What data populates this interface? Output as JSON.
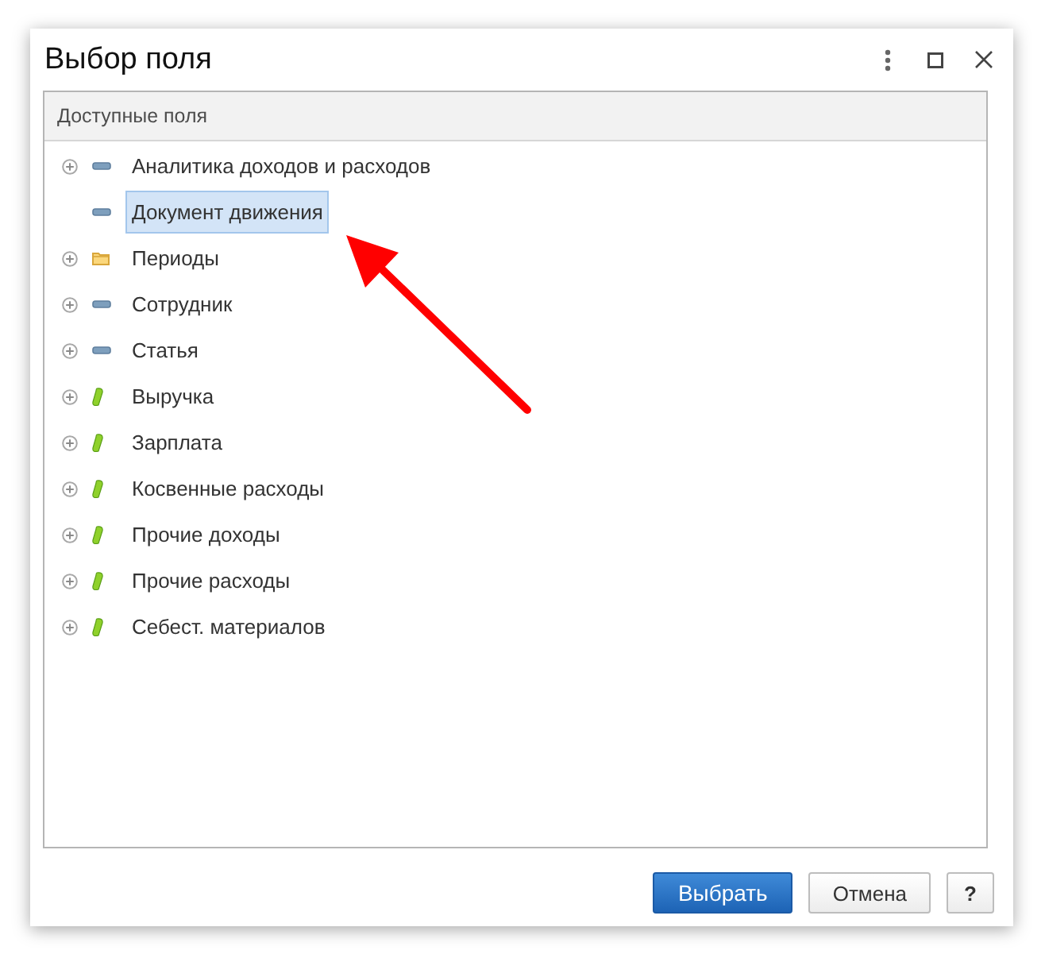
{
  "window": {
    "title": "Выбор поля"
  },
  "tree": {
    "header": "Доступные поля",
    "items": [
      {
        "label": "Аналитика доходов и расходов",
        "kind": "field",
        "expandable": true,
        "selected": false
      },
      {
        "label": "Документ движения",
        "kind": "field",
        "expandable": false,
        "selected": true
      },
      {
        "label": "Периоды",
        "kind": "folder",
        "expandable": true,
        "selected": false
      },
      {
        "label": "Сотрудник",
        "kind": "field",
        "expandable": true,
        "selected": false
      },
      {
        "label": "Статья",
        "kind": "field",
        "expandable": true,
        "selected": false
      },
      {
        "label": "Выручка",
        "kind": "resource",
        "expandable": true,
        "selected": false
      },
      {
        "label": "Зарплата",
        "kind": "resource",
        "expandable": true,
        "selected": false
      },
      {
        "label": "Косвенные расходы",
        "kind": "resource",
        "expandable": true,
        "selected": false
      },
      {
        "label": "Прочие доходы",
        "kind": "resource",
        "expandable": true,
        "selected": false
      },
      {
        "label": "Прочие расходы",
        "kind": "resource",
        "expandable": true,
        "selected": false
      },
      {
        "label": "Себест. материалов",
        "kind": "resource",
        "expandable": true,
        "selected": false
      }
    ]
  },
  "buttons": [
    {
      "label": "Выбрать",
      "kind": "primary"
    },
    {
      "label": "Отмена",
      "kind": "normal"
    },
    {
      "label": "?",
      "kind": "help"
    }
  ]
}
